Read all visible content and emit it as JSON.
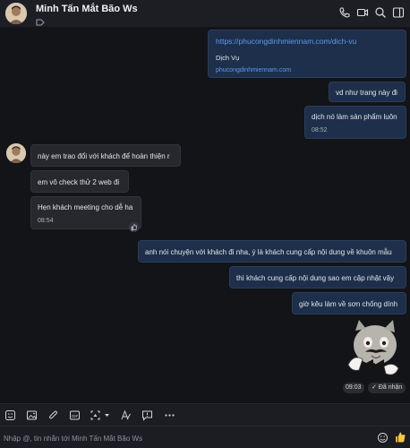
{
  "header": {
    "title": "Minh Tấn Mắt Bão Ws",
    "icons": [
      "phone-icon",
      "video-call-icon",
      "search-icon",
      "sidebar-toggle-icon"
    ]
  },
  "messages": {
    "link_card": {
      "url": "https://phucongdinhmiennam.com/dich-vu",
      "title": "Dịch Vụ",
      "domain": "phucongdinhmiennam.com"
    },
    "out1": "vd như trang này đi",
    "out2": "dịch nó làm sản phẩm luôn",
    "out2_time": "08:52",
    "in1": "này em trao đổi với khách để hoàn thiện r",
    "in2": "em vô check thử 2 web đi",
    "in3": "Hẹn khách meeting cho dễ ha",
    "in3_time": "08:54",
    "out3": "anh nói chuyện với khách đi nha, ý là khách cung cấp nội dung về khuôn mẫu",
    "out4": "thì khách cung cấp nội dung sao em cập nhật vậy",
    "out5": "giờ kêu làm về sơn chống dính",
    "sticker_time": "09:03",
    "seen_label": "Đã nhận"
  },
  "toolbar": {
    "icons": [
      "sticker-icon",
      "image-icon",
      "attachment-icon",
      "gif-icon",
      "screenshot-icon",
      "text-format-icon",
      "quick-reply-icon",
      "more-icon"
    ]
  },
  "composer": {
    "placeholder": "Nhập @, tin nhắn tới Minh Tấn Mắt Bão Ws"
  },
  "colors": {
    "accent": "#5b9bef",
    "outgoing_bubble": "#1d2f4a",
    "incoming_bubble": "#26282d"
  }
}
